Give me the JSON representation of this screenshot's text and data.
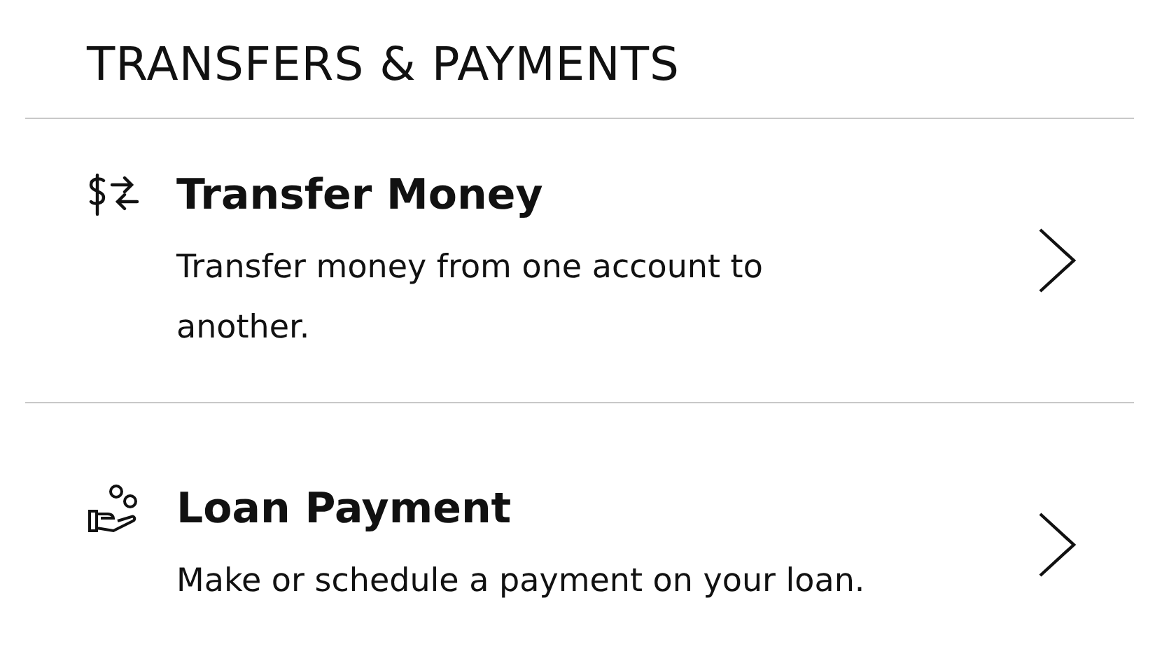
{
  "section_title": "TRANSFERS & PAYMENTS",
  "items": [
    {
      "kind": "transfer",
      "title": "Transfer Money",
      "description": "Transfer money from one account to another."
    },
    {
      "kind": "loan",
      "title": "Loan Payment",
      "description": "Make or schedule a payment on your loan."
    }
  ]
}
